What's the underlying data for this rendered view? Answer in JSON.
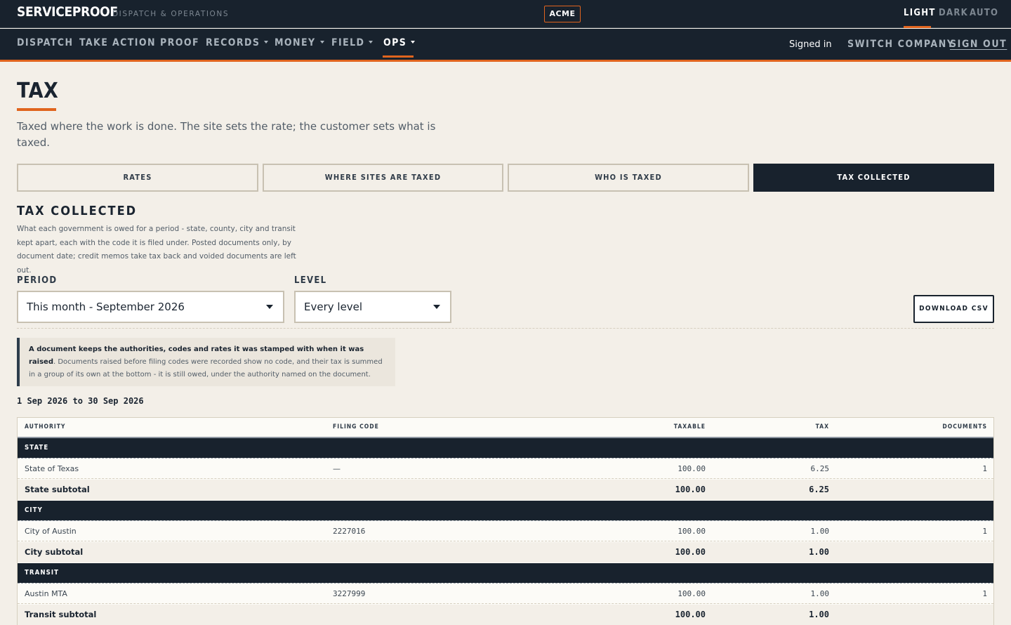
{
  "header": {
    "brand": "SERVICEPROOF",
    "tagline": "DISPATCH & OPERATIONS",
    "company": "ACME",
    "themes": [
      "LIGHT",
      "DARK",
      "AUTO"
    ],
    "active_theme": "LIGHT"
  },
  "nav": {
    "items": [
      {
        "label": "DISPATCH",
        "has_menu": false
      },
      {
        "label": "TAKE ACTION",
        "has_menu": false
      },
      {
        "label": "PROOF",
        "has_menu": false
      },
      {
        "label": "RECORDS",
        "has_menu": true
      },
      {
        "label": "MONEY",
        "has_menu": true
      },
      {
        "label": "FIELD",
        "has_menu": true
      },
      {
        "label": "OPS",
        "has_menu": true
      }
    ],
    "active": "OPS",
    "signed_in": "Signed in",
    "switch_company": "SWITCH COMPANY",
    "sign_out": "SIGN OUT"
  },
  "page": {
    "title": "TAX",
    "subtitle": "Taxed where the work is done. The site sets the rate; the customer sets what is taxed."
  },
  "tabs": [
    {
      "label": "RATES",
      "active": false
    },
    {
      "label": "WHERE SITES ARE TAXED",
      "active": false
    },
    {
      "label": "WHO IS TAXED",
      "active": false
    },
    {
      "label": "TAX COLLECTED",
      "active": true
    }
  ],
  "section": {
    "title": "TAX COLLECTED",
    "description": "What each government is owed for a period - state, county, city and transit kept apart, each with the code it is filed under. Posted documents only, by document date; credit memos take tax back and voided documents are left out."
  },
  "filters": {
    "period_label": "PERIOD",
    "period_value": "This month - September 2026",
    "level_label": "LEVEL",
    "level_value": "Every level",
    "download_label": "DOWNLOAD CSV"
  },
  "note": {
    "bold": "A document keeps the authorities, codes and rates it was stamped with when it was raised",
    "text": ". Documents raised before filing codes were recorded show no code, and their tax is summed in a group of its own at the bottom - it is still owed, under the authority named on the document."
  },
  "range_text": "1 Sep 2026 to 30 Sep 2026",
  "table": {
    "columns": [
      "AUTHORITY",
      "FILING CODE",
      "TAXABLE",
      "TAX",
      "DOCUMENTS"
    ],
    "groups": [
      {
        "name": "STATE",
        "rows": [
          {
            "authority": "State of Texas",
            "code": "—",
            "taxable": "100.00",
            "tax": "6.25",
            "docs": "1"
          }
        ],
        "subtotal_label": "State subtotal",
        "subtotal_taxable": "100.00",
        "subtotal_tax": "6.25"
      },
      {
        "name": "CITY",
        "rows": [
          {
            "authority": "City of Austin",
            "code": "2227016",
            "taxable": "100.00",
            "tax": "1.00",
            "docs": "1"
          }
        ],
        "subtotal_label": "City subtotal",
        "subtotal_taxable": "100.00",
        "subtotal_tax": "1.00"
      },
      {
        "name": "TRANSIT",
        "rows": [
          {
            "authority": "Austin MTA",
            "code": "3227999",
            "taxable": "100.00",
            "tax": "1.00",
            "docs": "1"
          }
        ],
        "subtotal_label": "Transit subtotal",
        "subtotal_taxable": "100.00",
        "subtotal_tax": "1.00"
      }
    ]
  },
  "colors": {
    "navy": "#18222d",
    "accent": "#e0641e",
    "background": "#f3efe8"
  }
}
